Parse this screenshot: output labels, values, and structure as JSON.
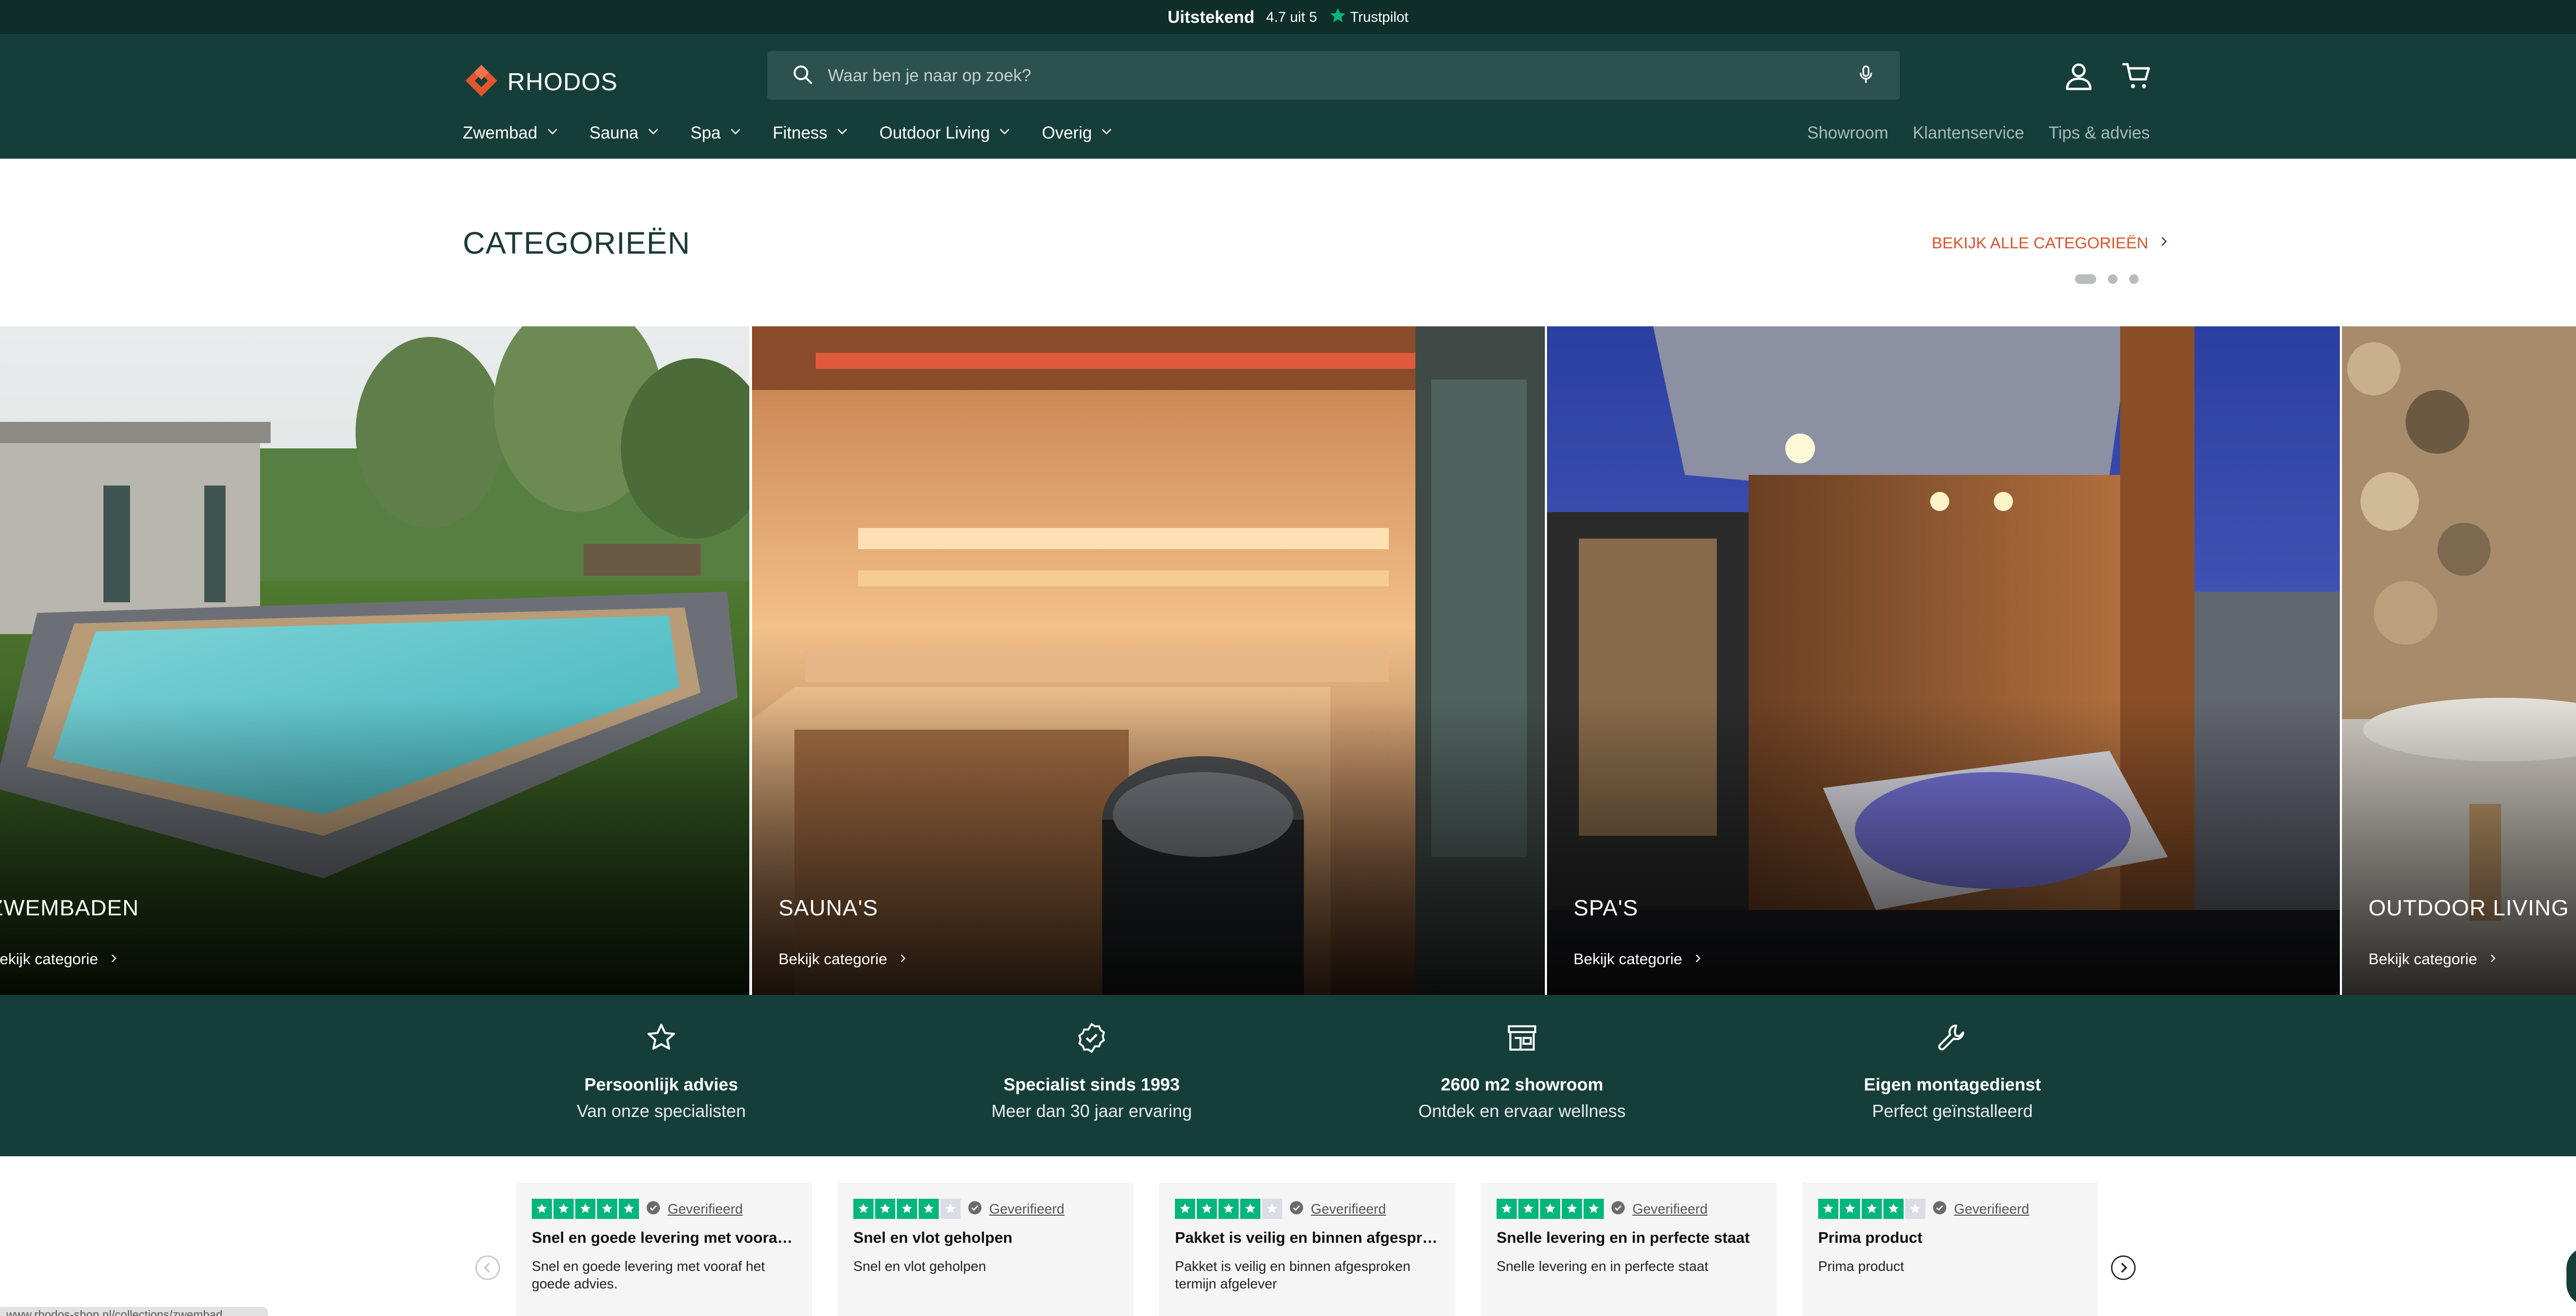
{
  "topbar": {
    "rating_word": "Uitstekend",
    "rating_score": "4.7 uit 5",
    "brand": "Trustpilot"
  },
  "header": {
    "logo_text": "RHODOS",
    "search_placeholder": "Waar ben je naar op zoek?",
    "nav": [
      "Zwembad",
      "Sauna",
      "Spa",
      "Fitness",
      "Outdoor Living",
      "Overig"
    ],
    "nav_right": [
      "Showroom",
      "Klantenservice",
      "Tips & advies"
    ]
  },
  "categories": {
    "title": "CATEGORIEËN",
    "view_all": "BEKIJK ALLE CATEGORIEËN",
    "link_label": "Bekijk categorie",
    "items": [
      {
        "title": "ZWEMBADEN",
        "link": "Bekijk categorie"
      },
      {
        "title": "SAUNA'S",
        "link": "Bekijk categorie"
      },
      {
        "title": "SPA'S",
        "link": "Bekijk categorie"
      },
      {
        "title": "OUTDOOR LIVING",
        "link": "Bekijk categorie"
      }
    ]
  },
  "usp": [
    {
      "title": "Persoonlijk advies",
      "sub": "Van onze specialisten",
      "icon": "star-icon"
    },
    {
      "title": "Specialist sinds 1993",
      "sub": "Meer dan 30 jaar ervaring",
      "icon": "badge-check-icon"
    },
    {
      "title": "2600 m2 showroom",
      "sub": "Ontdek en ervaar wellness",
      "icon": "store-icon"
    },
    {
      "title": "Eigen montagedienst",
      "sub": "Perfect geïnstalleerd",
      "icon": "wrench-icon"
    }
  ],
  "reviews": {
    "verified_label": "Geverifieerd",
    "items": [
      {
        "stars": 5,
        "title": "Snel en goede levering met vooraf ...",
        "body": "Snel en goede levering met vooraf het goede advies."
      },
      {
        "stars": 4,
        "title": "Snel en vlot geholpen",
        "body": "Snel en vlot geholpen"
      },
      {
        "stars": 4,
        "title": "Pakket is veilig en binnen afgespro...",
        "body": "Pakket is veilig en binnen afgesproken termijn afgelever"
      },
      {
        "stars": 5,
        "title": "Snelle levering en in perfecte staat",
        "body": "Snelle levering en in perfecte staat"
      },
      {
        "stars": 4,
        "title": "Prima product",
        "body": "Prima product"
      }
    ]
  },
  "status_url": "www.rhodos-shop.nl/collections/zwembad",
  "colors": {
    "brand_dark": "#163e39",
    "accent": "#d4542e",
    "trustpilot_green": "#00b67a"
  }
}
